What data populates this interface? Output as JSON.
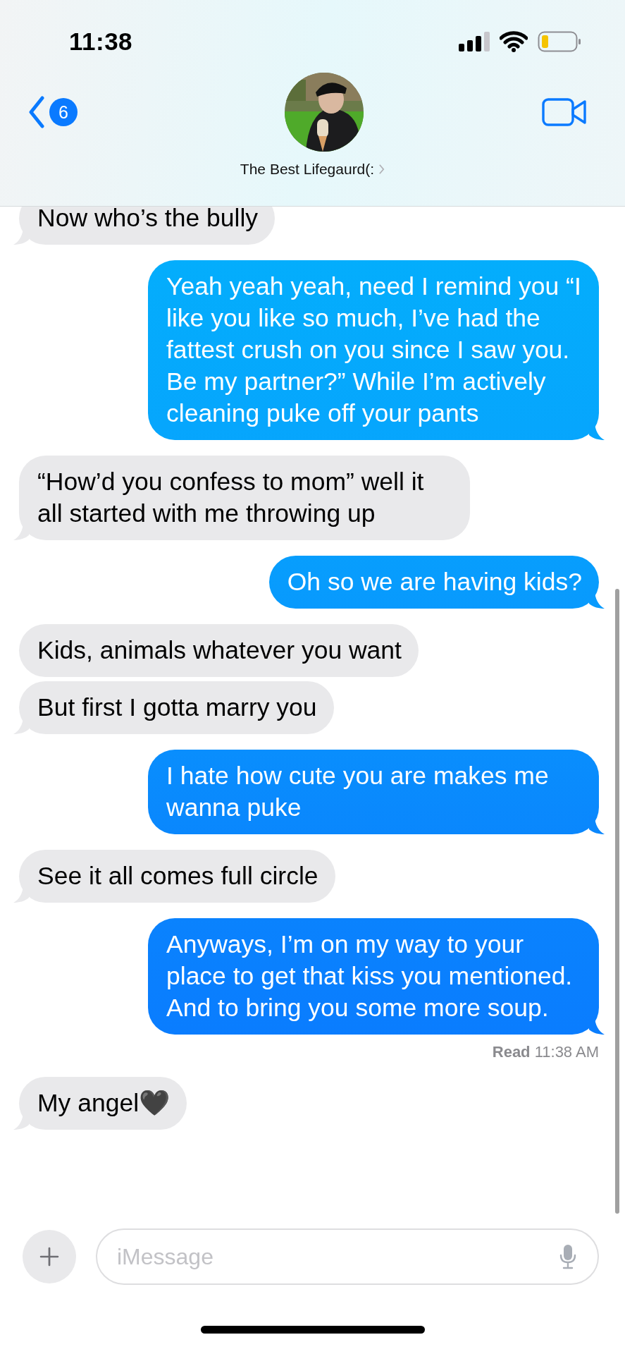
{
  "status_bar": {
    "time": "11:38"
  },
  "header": {
    "back_badge": "6",
    "contact_name": "The Best Lifegaurd(:"
  },
  "messages": [
    {
      "kind": "received",
      "tail": true,
      "text": "Now who’s the bully"
    },
    {
      "kind": "sent",
      "tail": true,
      "text": "Yeah yeah yeah, need I remind you “I like you like so much, I’ve had the fattest crush on you since I saw you. Be my partner?” While I’m actively cleaning puke off your pants"
    },
    {
      "kind": "received",
      "tail": true,
      "text": "“How’d you confess to mom” well it all started with me throwing up"
    },
    {
      "kind": "sent",
      "tail": true,
      "text": "Oh so we are having kids?"
    },
    {
      "kind": "received",
      "tail": false,
      "text": "Kids, animals whatever you want"
    },
    {
      "kind": "received",
      "tail": true,
      "text": "But first I gotta marry you"
    },
    {
      "kind": "sent",
      "tail": true,
      "text": "I hate how cute you are makes me wanna puke"
    },
    {
      "kind": "received",
      "tail": true,
      "text": "See it all comes full circle"
    },
    {
      "kind": "sent",
      "tail": true,
      "text": "Anyways, I’m on my way to your place to get that kiss you mentioned. And to bring you some more soup.",
      "receipt": "**Read** 11:38 AM"
    },
    {
      "kind": "received",
      "tail": true,
      "text": "My angel🖤"
    }
  ],
  "composer": {
    "placeholder": "iMessage"
  }
}
